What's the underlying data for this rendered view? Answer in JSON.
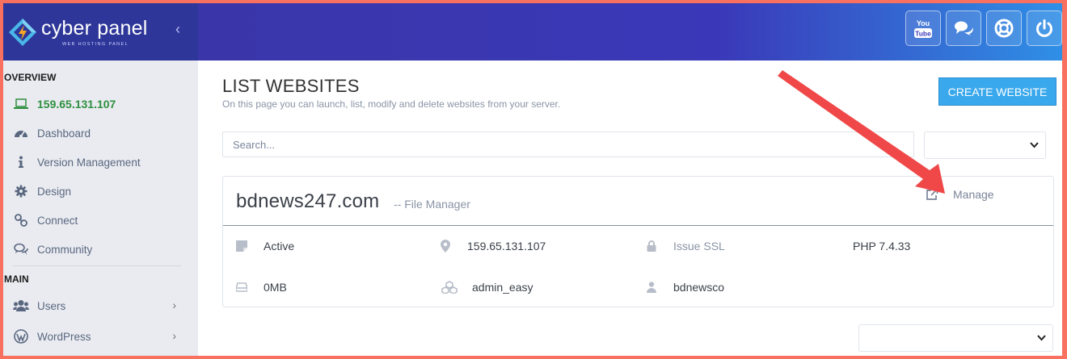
{
  "brand": {
    "name": "cyber panel",
    "tagline": "WEB HOSTING PANEL"
  },
  "sidebar": {
    "overview_title": "OVERVIEW",
    "ip": "159.65.131.107",
    "items": [
      {
        "label": "Dashboard",
        "icon": "dashboard-icon"
      },
      {
        "label": "Version Management",
        "icon": "info-icon"
      },
      {
        "label": "Design",
        "icon": "gear-icon"
      },
      {
        "label": "Connect",
        "icon": "link-icon"
      },
      {
        "label": "Community",
        "icon": "comments-icon"
      }
    ],
    "main_title": "MAIN",
    "main_items": [
      {
        "label": "Users",
        "icon": "users-icon"
      },
      {
        "label": "WordPress",
        "icon": "wordpress-icon"
      }
    ]
  },
  "header": {
    "buttons": [
      "youtube-icon",
      "chat-icon",
      "support-icon",
      "power-icon"
    ],
    "youtube_text": "You Tube"
  },
  "page": {
    "title": "LIST WEBSITES",
    "subtitle": "On this page you can launch, list, modify and delete websites from your server.",
    "create_button": "CREATE WEBSITE",
    "search_placeholder": "Search..."
  },
  "website": {
    "domain": "bdnews247.com",
    "file_manager": "-- File Manager",
    "manage": "Manage",
    "status": "Active",
    "ip": "159.65.131.107",
    "ssl": "Issue SSL",
    "php": "PHP 7.4.33",
    "disk": "0MB",
    "package": "admin_easy",
    "owner": "bdnewsco"
  },
  "colors": {
    "accent": "#3aa8ec",
    "header_start": "#3a36a9",
    "header_end": "#2f8fe6",
    "arrow": "#f04848",
    "ip_green": "#2f8f3f"
  }
}
